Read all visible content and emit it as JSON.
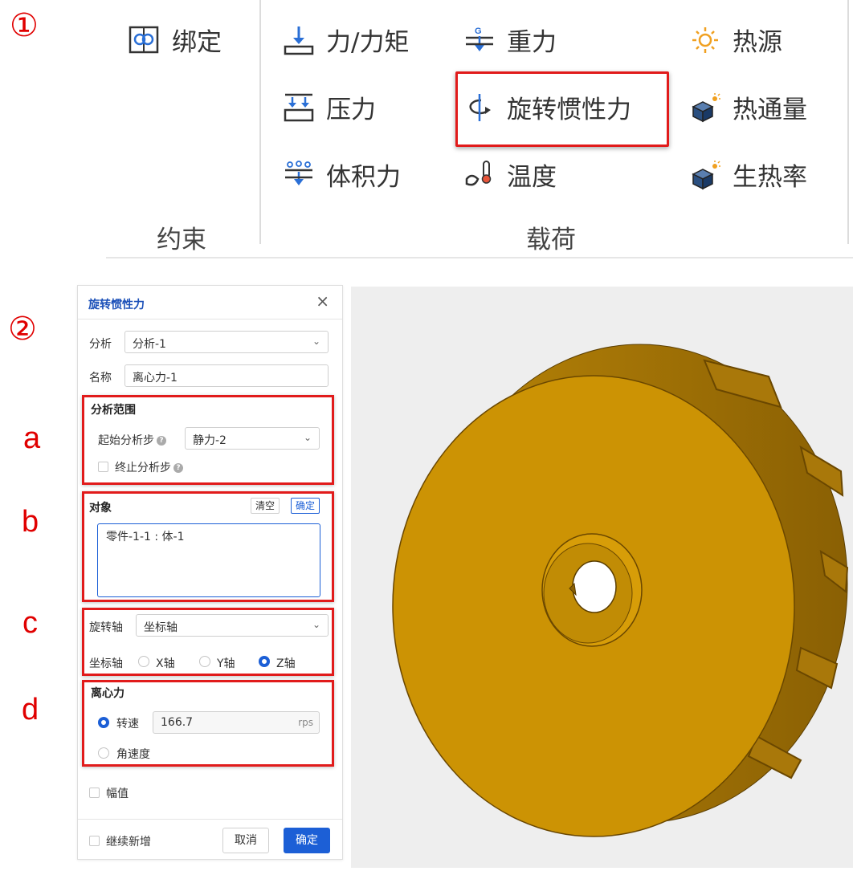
{
  "markers": {
    "one": "①",
    "two": "②",
    "a": "a",
    "b": "b",
    "c": "c",
    "d": "d"
  },
  "colors": {
    "accent": "#1c5fd6",
    "highlight": "#e11b1b",
    "model": "#c8940a"
  },
  "ribbon": {
    "constraint_group": {
      "label": "约束",
      "items": [
        {
          "label": "绑定",
          "icon": "bind-icon"
        }
      ]
    },
    "load_group": {
      "label": "载荷",
      "items": [
        {
          "label": "力/力矩",
          "icon": "force-moment-icon"
        },
        {
          "label": "重力",
          "icon": "gravity-icon"
        },
        {
          "label": "热源",
          "icon": "heat-source-icon"
        },
        {
          "label": "压力",
          "icon": "pressure-icon"
        },
        {
          "label": "旋转惯性力",
          "icon": "rotational-inertia-icon",
          "highlighted": true
        },
        {
          "label": "热通量",
          "icon": "heat-flux-icon"
        },
        {
          "label": "体积力",
          "icon": "body-force-icon"
        },
        {
          "label": "温度",
          "icon": "temperature-icon"
        },
        {
          "label": "生热率",
          "icon": "heat-generation-icon"
        }
      ]
    }
  },
  "dialog": {
    "title": "旋转惯性力",
    "close": "×",
    "analysis": {
      "label": "分析",
      "value": "分析-1"
    },
    "name": {
      "label": "名称",
      "value": "离心力-1"
    },
    "scope": {
      "title": "分析范围",
      "start_step_label": "起始分析步",
      "start_step_value": "静力-2",
      "end_step_label": "终止分析步",
      "end_step_checked": false
    },
    "object": {
      "title": "对象",
      "clear_label": "清空",
      "confirm_label": "确定",
      "selection": "零件-1-1 : 体-1"
    },
    "axis": {
      "label": "旋转轴",
      "value": "坐标轴",
      "coord_label": "坐标轴",
      "options": [
        "X轴",
        "Y轴",
        "Z轴"
      ],
      "selected": "Z轴"
    },
    "centrifugal": {
      "title": "离心力",
      "speed_label": "转速",
      "speed_value": "166.7",
      "speed_unit": "rps",
      "angular_label": "角速度",
      "selected": "转速"
    },
    "amplitude": {
      "label": "幅值",
      "checked": false
    },
    "footer": {
      "continue_label": "继续新增",
      "continue_checked": false,
      "cancel_label": "取消",
      "ok_label": "确定"
    }
  }
}
